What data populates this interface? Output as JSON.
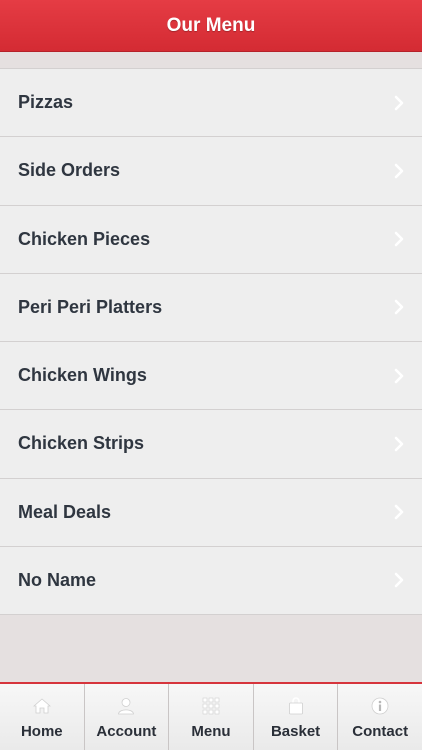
{
  "header": {
    "title": "Our Menu"
  },
  "menu": {
    "items": [
      {
        "label": "Pizzas"
      },
      {
        "label": "Side Orders"
      },
      {
        "label": "Chicken Pieces"
      },
      {
        "label": "Peri Peri Platters"
      },
      {
        "label": "Chicken Wings"
      },
      {
        "label": "Chicken Strips"
      },
      {
        "label": "Meal Deals"
      },
      {
        "label": "No Name"
      }
    ]
  },
  "tabbar": {
    "tabs": [
      {
        "label": "Home",
        "icon": "home-icon"
      },
      {
        "label": "Account",
        "icon": "user-icon"
      },
      {
        "label": "Menu",
        "icon": "grid-icon"
      },
      {
        "label": "Basket",
        "icon": "bag-icon"
      },
      {
        "label": "Contact",
        "icon": "info-icon"
      }
    ]
  },
  "colors": {
    "header_red": "#d42b33",
    "text_dark": "#2f3640",
    "row_bg": "#eeeeee",
    "page_bg": "#e5e0e0"
  }
}
